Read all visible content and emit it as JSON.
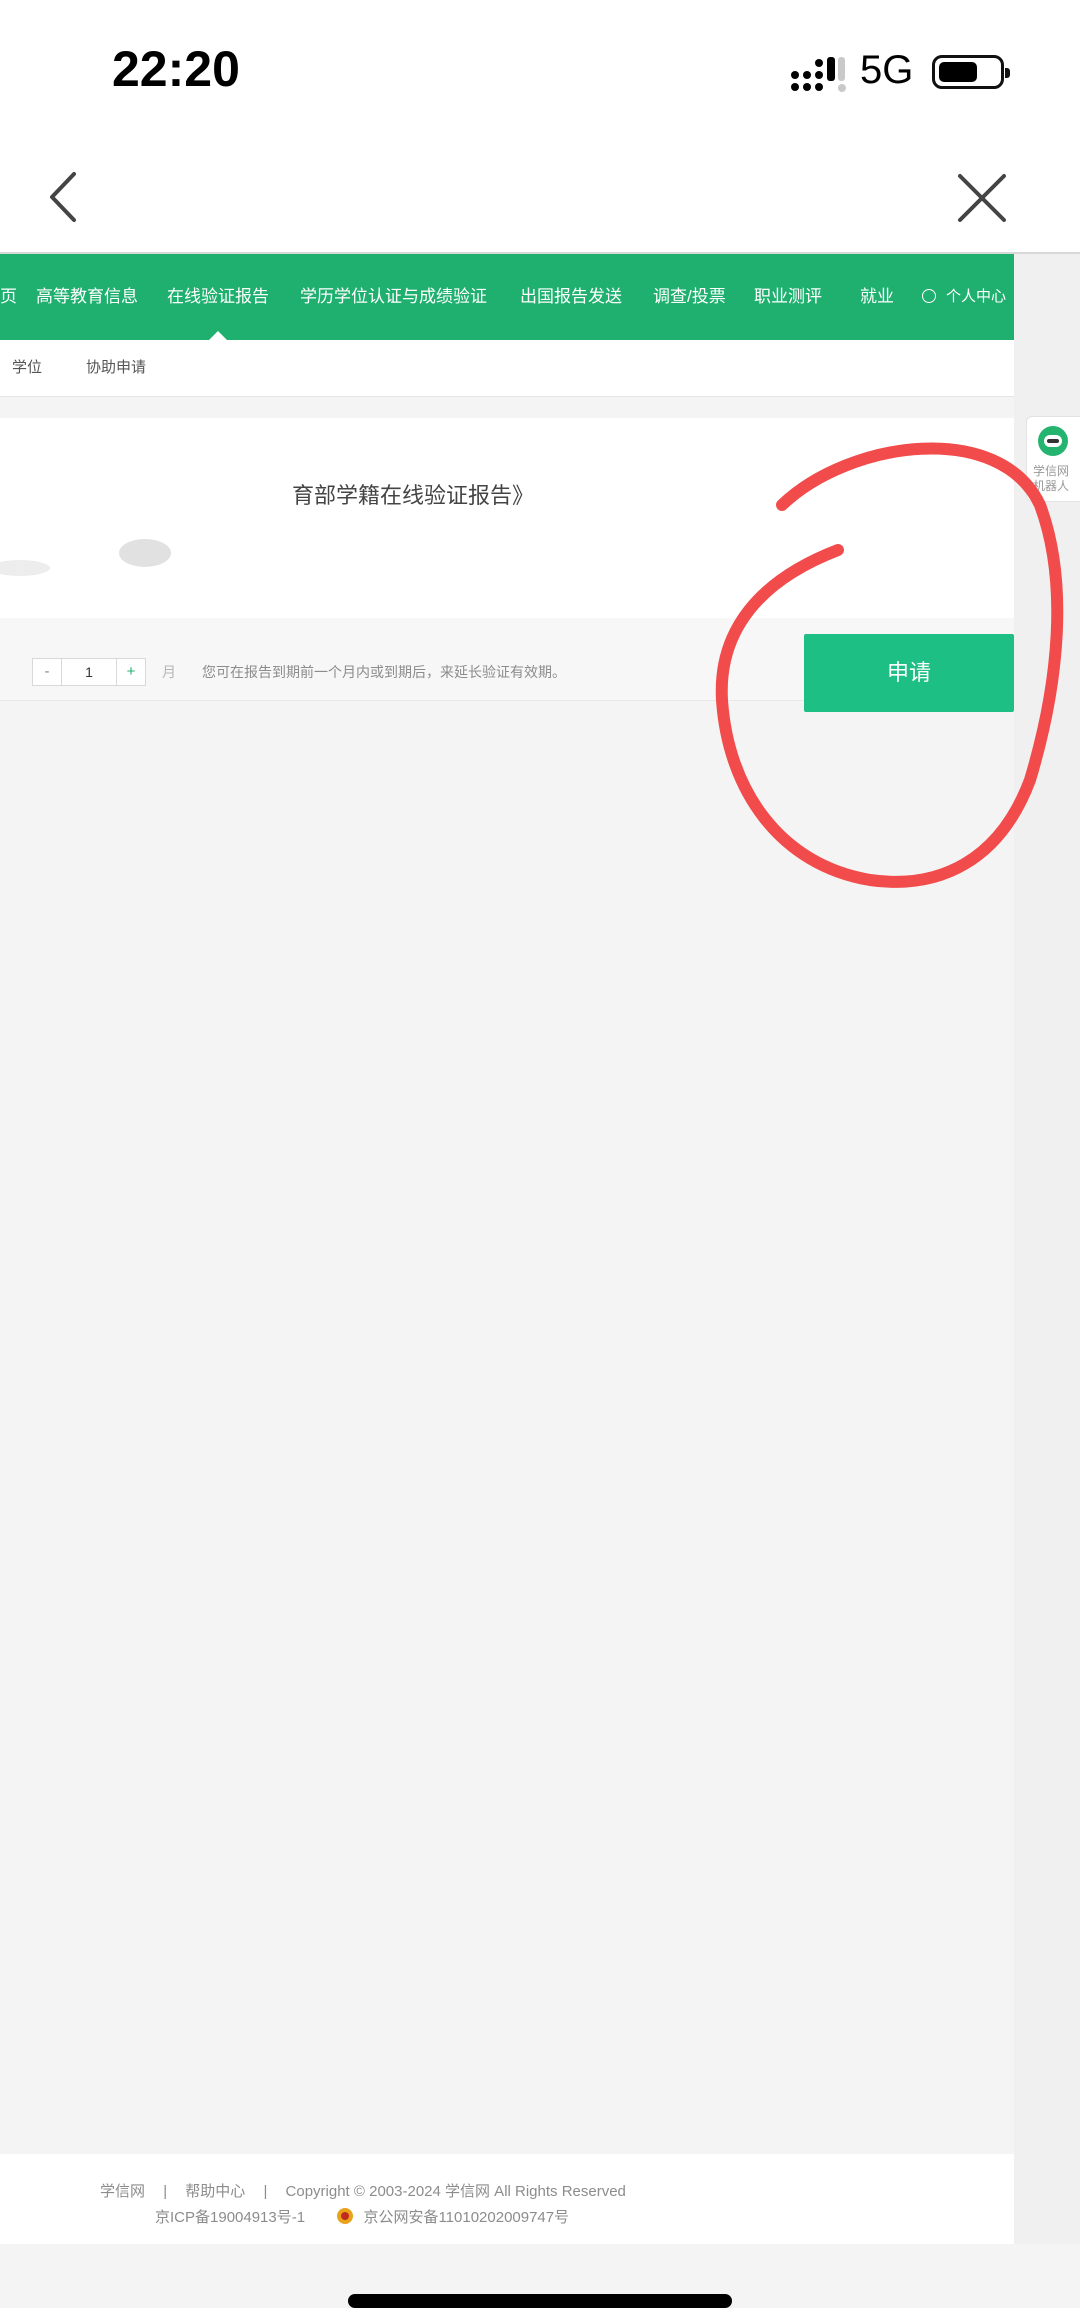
{
  "status_bar": {
    "time": "22:20",
    "network": "5G",
    "icons": [
      "signal-icon",
      "battery-icon"
    ]
  },
  "nav_bar": {
    "back_icon": "chevron-left-icon",
    "close_icon": "close-icon"
  },
  "top_nav": {
    "items": [
      {
        "label": "页"
      },
      {
        "label": "高等教育信息"
      },
      {
        "label": "在线验证报告",
        "active": true
      },
      {
        "label": "学历学位认证与成绩验证"
      },
      {
        "label": "出国报告发送"
      },
      {
        "label": "调查/投票"
      },
      {
        "label": "职业测评"
      },
      {
        "label": "就业"
      },
      {
        "label": "个人中心",
        "icon": "user-circle-icon"
      }
    ],
    "color": "#1fb06f"
  },
  "sub_nav": {
    "items": [
      {
        "label": "学位"
      },
      {
        "label": "协助申请"
      }
    ]
  },
  "content": {
    "doc_title": "育部学籍在线验证报告》",
    "stepper": {
      "minus": "-",
      "value": "1",
      "plus": "+"
    },
    "unit": "月",
    "hint": "您可在报告到期前一个月内或到期后，来延长验证有效期。",
    "apply_button": "申请",
    "accent_color": "#1dbf84"
  },
  "robot": {
    "line1": "学信网",
    "line2": "机器人",
    "icon": "robot-avatar-icon"
  },
  "footer": {
    "links": [
      "学信网",
      "帮助中心"
    ],
    "separator": "|",
    "copyright": "Copyright © 2003-2024 学信网 All Rights Reserved",
    "icp": "京ICP备19004913号-1",
    "police_record": "京公网安备11010202009747号",
    "police_icon": "police-badge-icon"
  },
  "annotation": {
    "color": "#f24b4b",
    "shape": "hand-drawn-circle"
  }
}
